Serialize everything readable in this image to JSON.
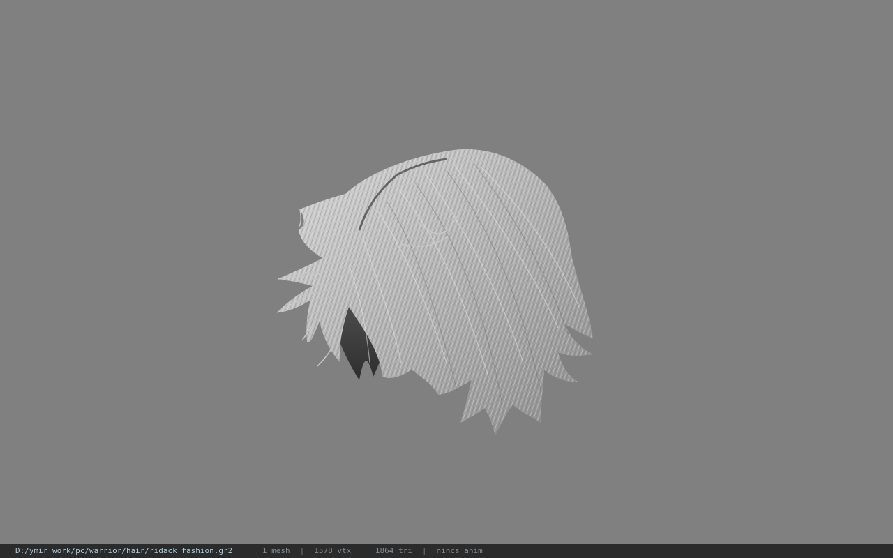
{
  "viewer": {
    "background_color": "#808080",
    "model_icon": "hair-mesh"
  },
  "status": {
    "file_path": "D:/ymir work/pc/warrior/hair/ridack_fashion.gr2",
    "separator": "|",
    "mesh_count": "1 mesh",
    "vertex_count": "1578 vtx",
    "triangle_count": "1864 tri",
    "anim_status": "nincs anim"
  }
}
